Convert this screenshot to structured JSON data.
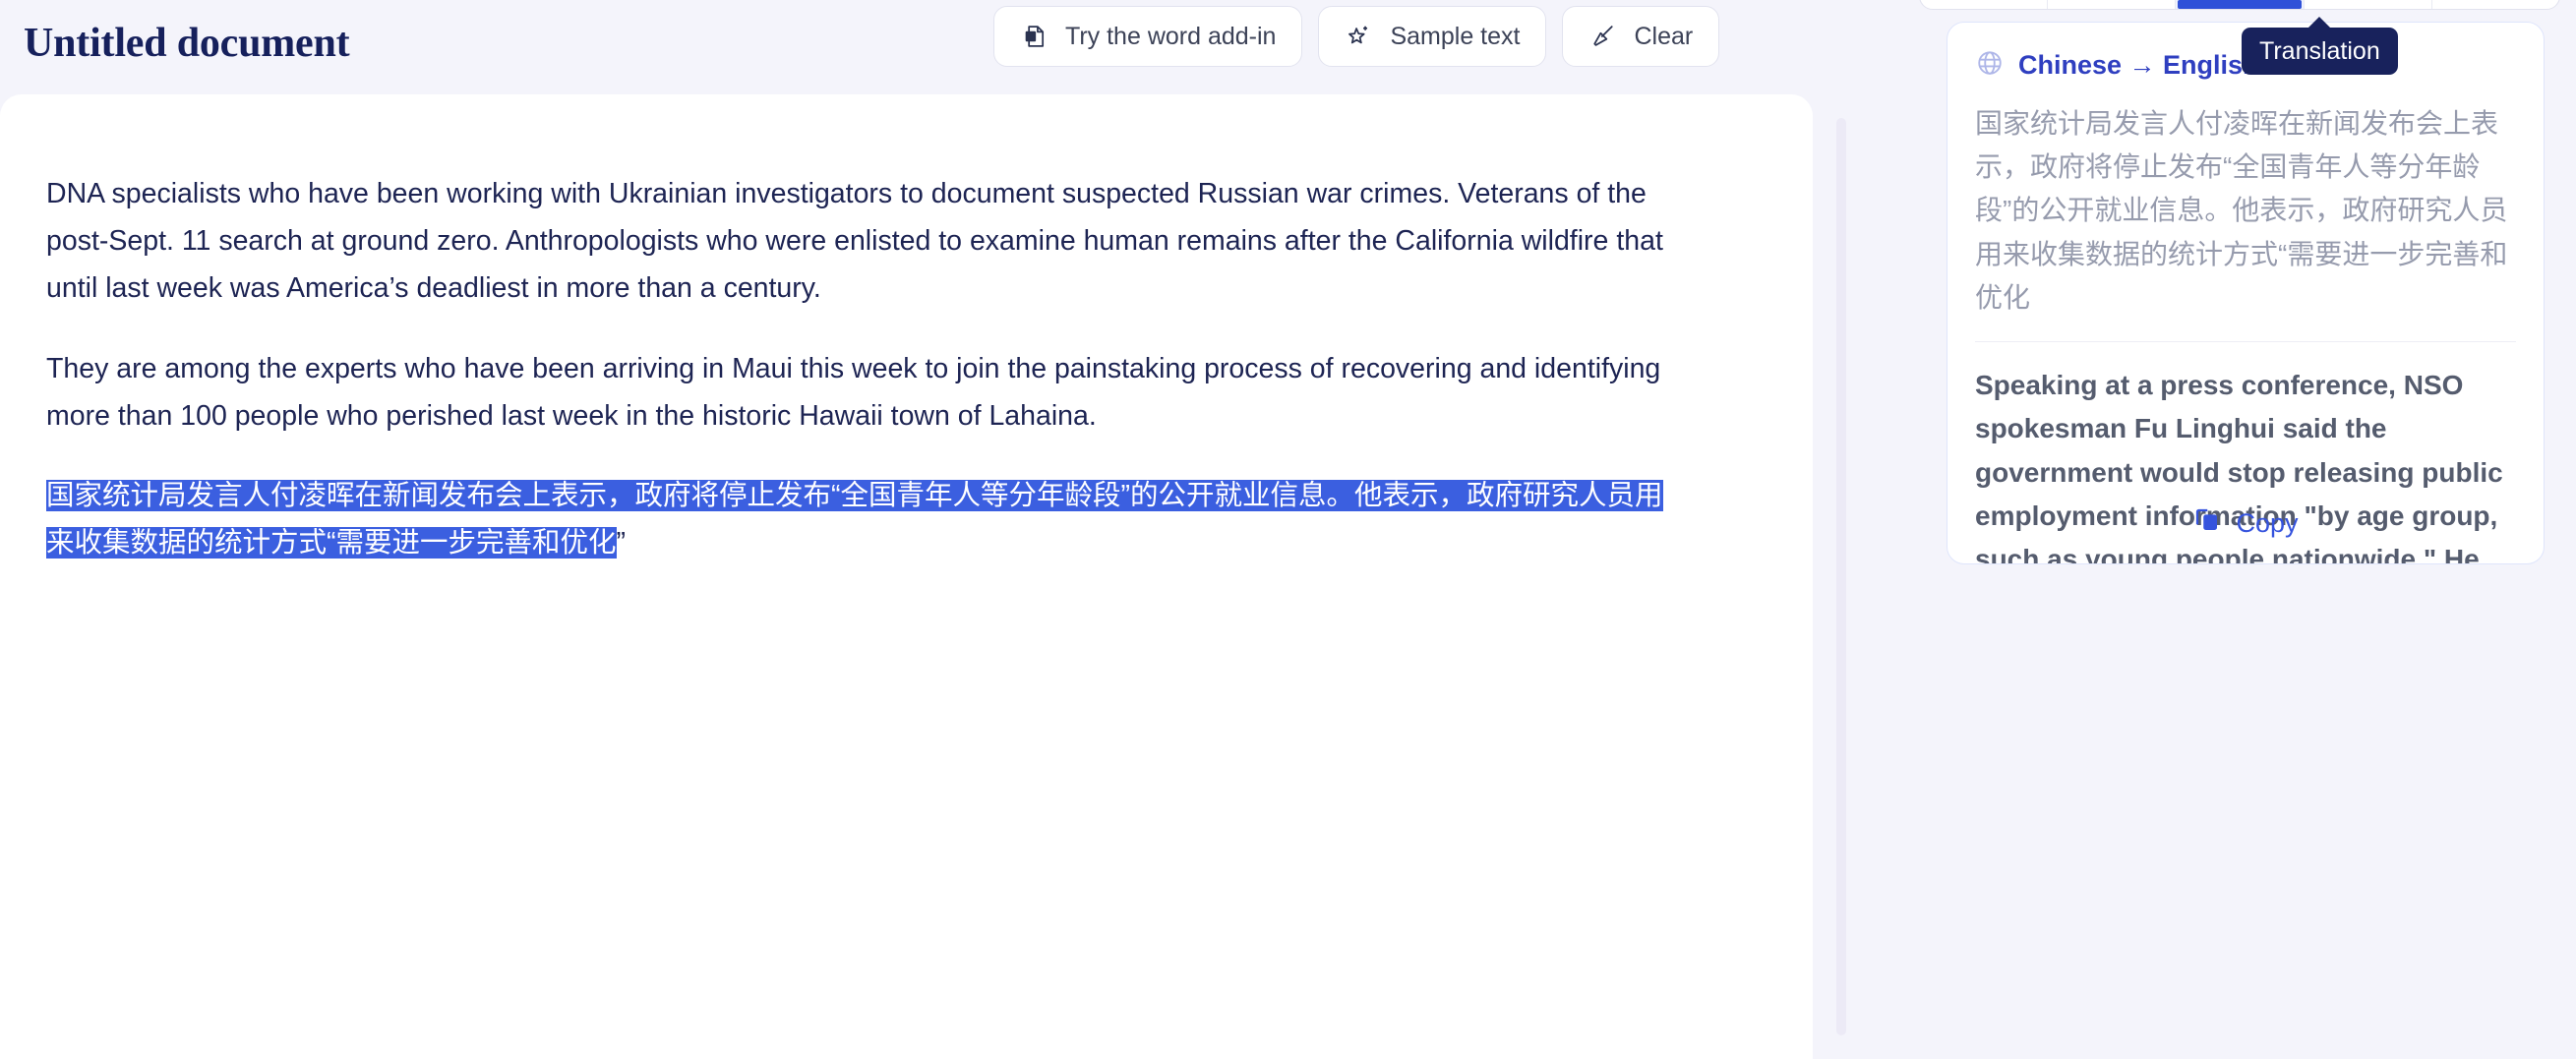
{
  "document": {
    "title": "Untitled document",
    "paragraphs": [
      "DNA specialists who have been working with Ukrainian investigators to document suspected Russian war crimes. Veterans of the post-Sept. 11 search at ground zero. Anthropologists who were enlisted to examine human remains after the California wildfire that until last week was America’s deadliest in more than a century.",
      "They are among the experts who have been arriving in Maui this week to join the painstaking process of recovering and identifying more than 100 people who perished last week in the historic Hawaii town of Lahaina."
    ],
    "selected_text": "国家统计局发言人付凌晖在新闻发布会上表示，政府将停止发布“全国青年人等分年龄段”的公开就业信息。他表示，政府研究人员用来收集数据的统计方式“需要进一步完善和优化",
    "selected_text_tail": "”"
  },
  "toolbar": {
    "buttons": [
      {
        "label": "Try the word add-in",
        "icon": "word-document-icon"
      },
      {
        "label": "Sample text",
        "icon": "sparkle-star-icon"
      },
      {
        "label": "Clear",
        "icon": "broom-icon"
      }
    ]
  },
  "right_panel": {
    "tooltip": "Translation",
    "tabs": [
      {
        "label": "",
        "active": false
      },
      {
        "label": "",
        "active": false
      },
      {
        "label": "",
        "active": true
      },
      {
        "label": "",
        "active": false
      },
      {
        "label": "",
        "active": false
      }
    ],
    "language_pair": "Chinese → English",
    "language_icon": "globe-icon",
    "source_text": "国家统计局发言人付凌晖在新闻发布会上表示，政府将停止发布“全国青年人等分年龄段”的公开就业信息。他表示，政府研究人员用来收集数据的统计方式“需要进一步完善和优化",
    "translated_text": "Speaking at a press conference, NSO spokesman Fu Linghui said the government would stop releasing public employment information \"by age group, such as young people nationwide.\" He said that the statistical methods used by government researchers to collect data \"need to be further improved and optimized\".",
    "copy_label": "Copy",
    "copy_icon": "copy-icon"
  },
  "colors": {
    "page_background": "#f4f4fb",
    "editor_background": "#ffffff",
    "title_color": "#16205c",
    "selection_blue": "#3b5fe0",
    "accent_blue": "#2f3fc0",
    "tooltip_navy": "#18225c",
    "muted_text": "#969bad"
  }
}
